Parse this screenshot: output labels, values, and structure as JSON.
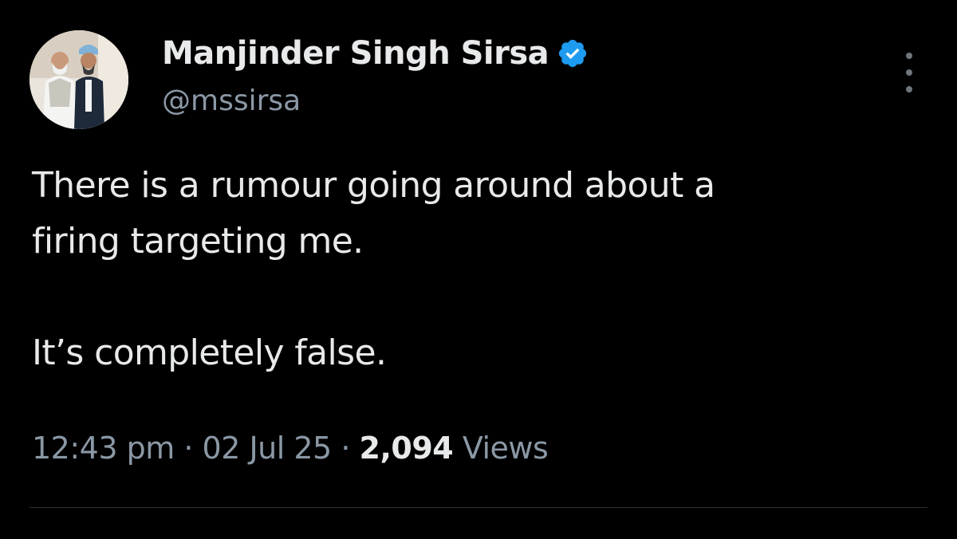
{
  "author": {
    "display_name": "Manjinder Singh Sirsa",
    "handle": "@mssirsa",
    "verified": true,
    "avatar_icon": "profile-photo"
  },
  "tweet": {
    "lines": [
      "There is a rumour going around about a",
      "firing targeting me.",
      "It’s completely false."
    ]
  },
  "meta": {
    "time": "12:43 pm",
    "separator": "·",
    "date": "02 Jul 25",
    "views_count": "2,094",
    "views_label": "Views"
  },
  "colors": {
    "background": "#000000",
    "primary_text": "#e7e9ea",
    "secondary_text": "#8b98a5",
    "verified_badge": "#1d9bf0",
    "divider": "#2f3336"
  },
  "icons": {
    "verified": "verified-badge-icon",
    "more": "more-options-icon"
  }
}
